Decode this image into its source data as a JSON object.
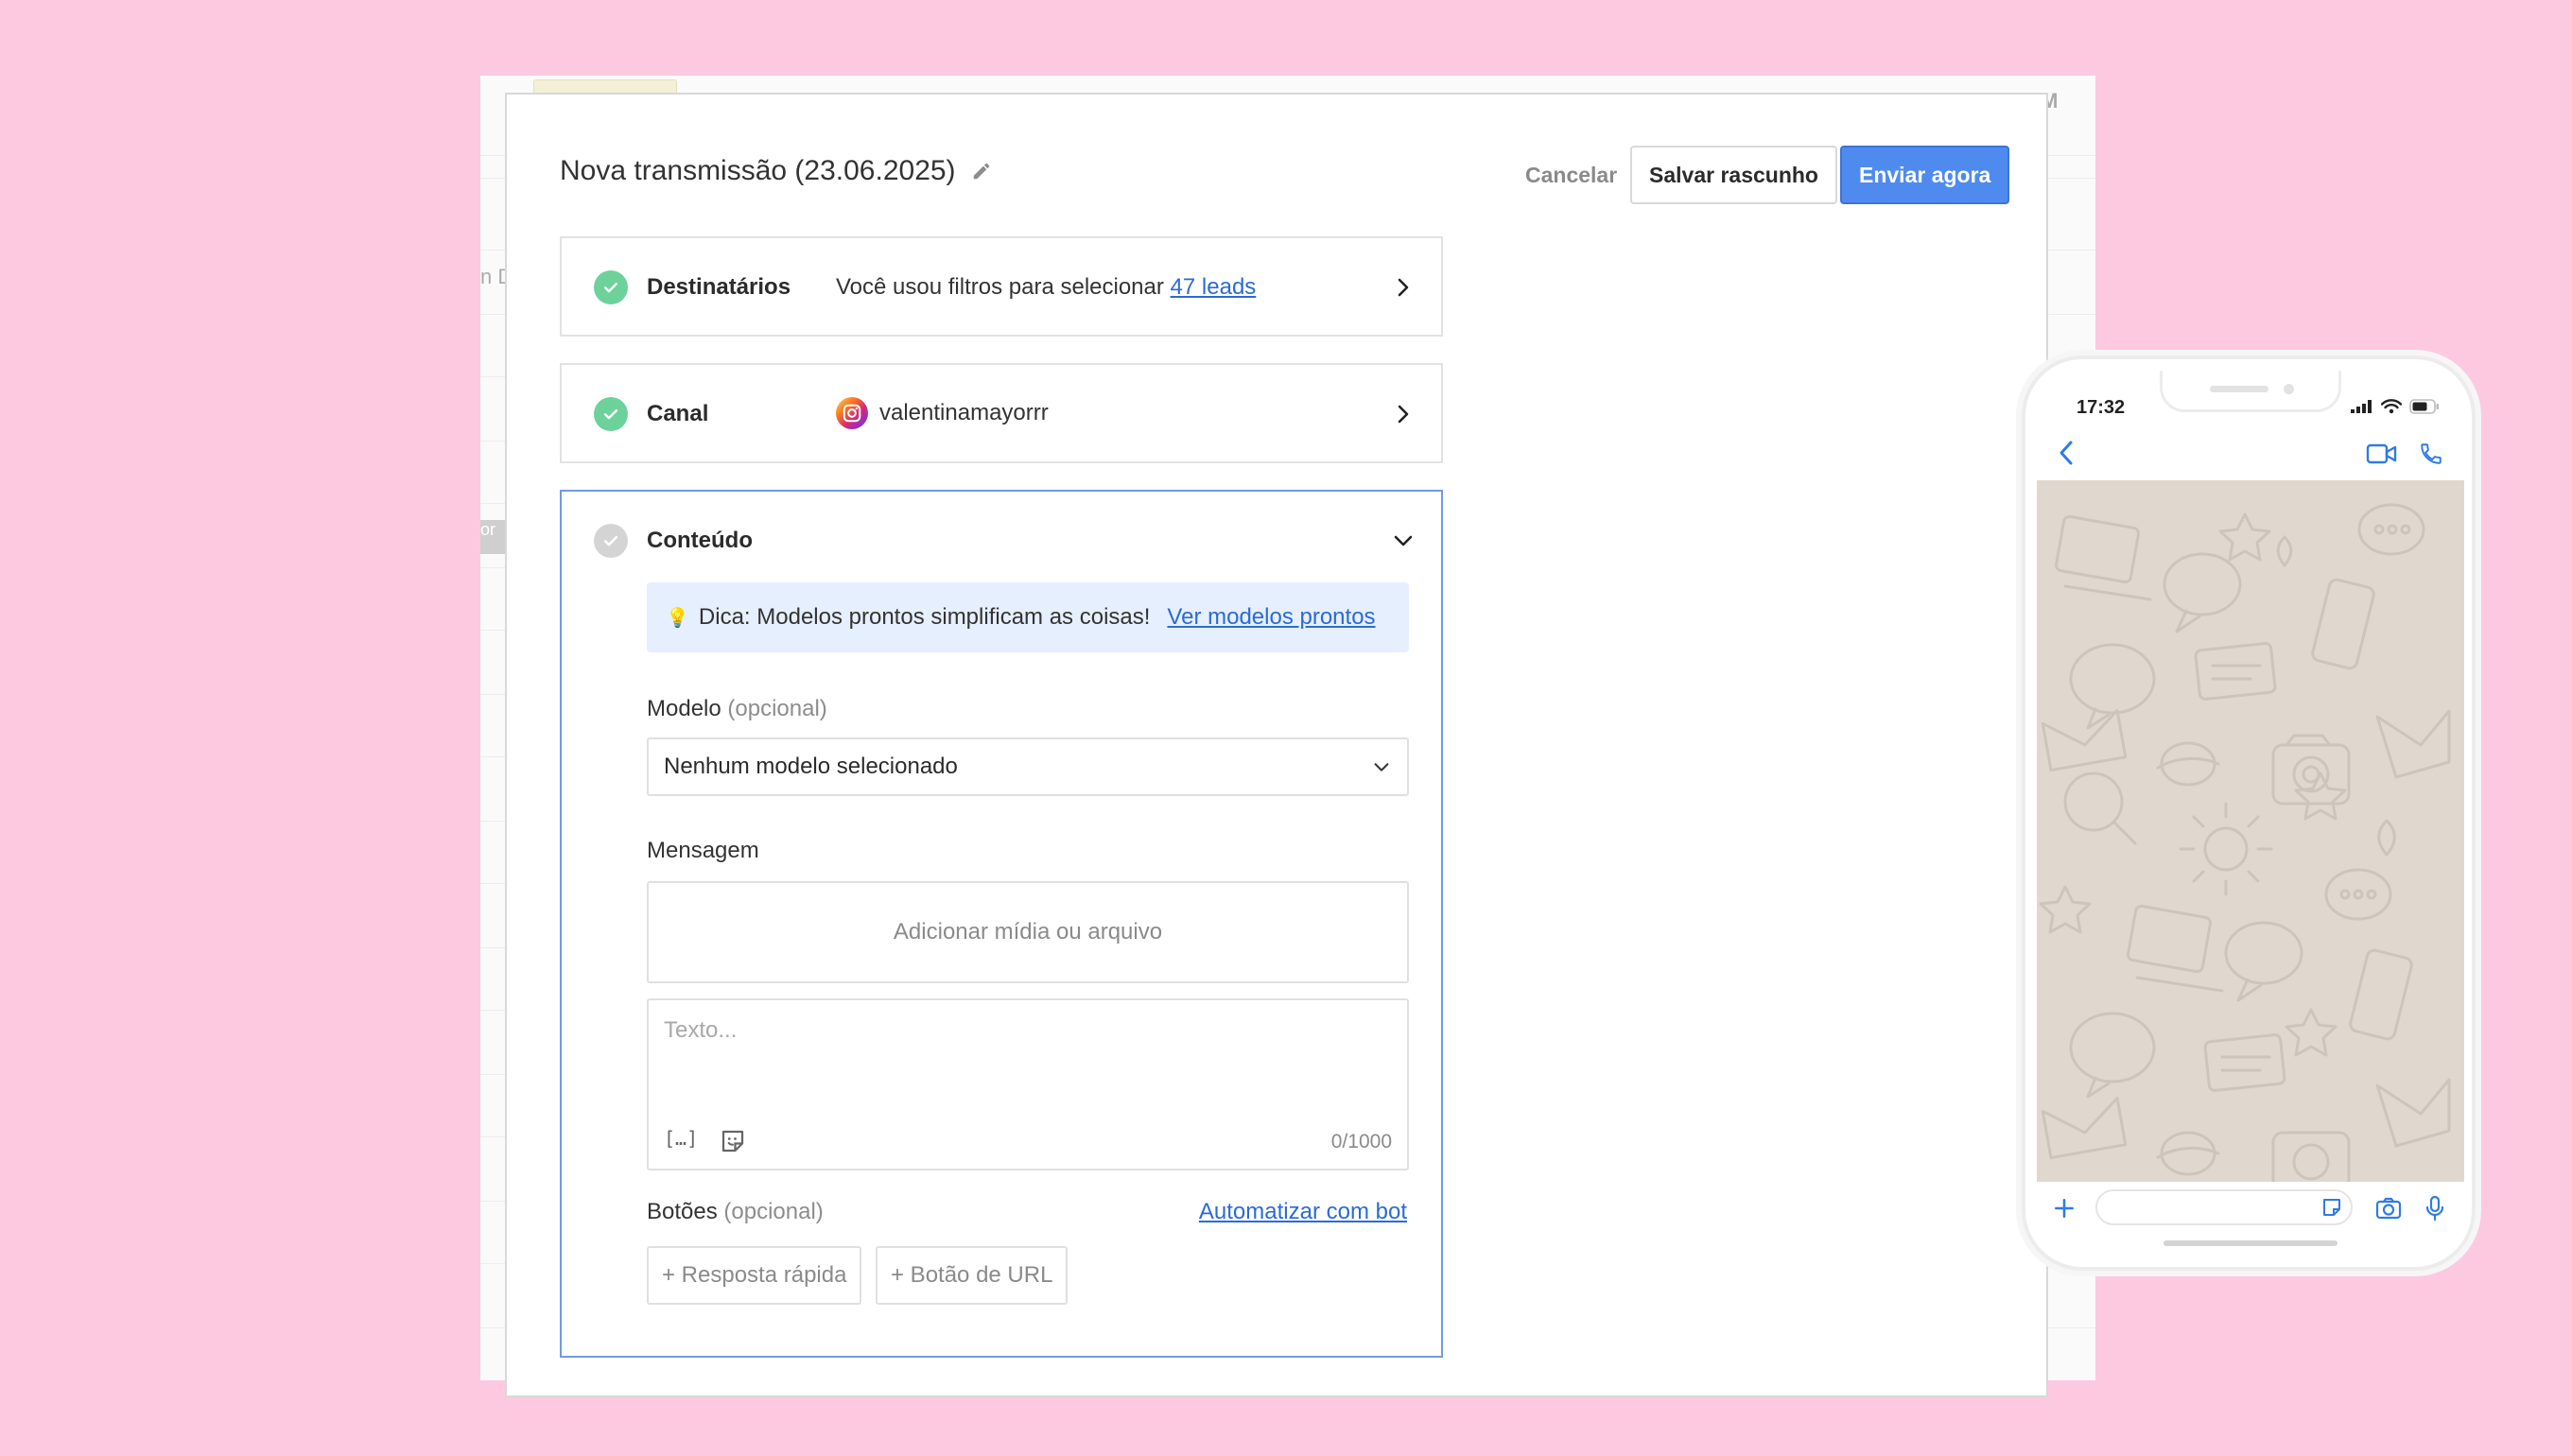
{
  "background_app": {
    "fragment_right": "TOM",
    "fragment_left": "n D",
    "fragment_label": "or"
  },
  "header": {
    "title": "Nova transmissão (23.06.2025)",
    "cancel_label": "Cancelar",
    "draft_label": "Salvar rascunho",
    "send_label": "Enviar agora"
  },
  "recipients": {
    "label": "Destinatários",
    "text": "Você usou filtros para selecionar",
    "link": "47 leads"
  },
  "channel": {
    "label": "Canal",
    "account": "valentinamayorrr",
    "icon": "instagram-icon"
  },
  "content": {
    "label": "Conteúdo",
    "tip_icon": "💡",
    "tip_text": "Dica: Modelos prontos simplificam as coisas!",
    "tip_link": "Ver modelos prontos",
    "model_label": "Modelo",
    "optional": "(opcional)",
    "model_selected": "Nenhum modelo selecionado",
    "message_label": "Mensagem",
    "media_label": "Adicionar mídia ou arquivo",
    "text_placeholder": "Texto...",
    "counter": "0/1000",
    "variable_icon": "[…]",
    "buttons_label": "Botões",
    "automate_link": "Automatizar com bot",
    "quick_reply": "+ Resposta rápida",
    "url_button": "+ Botão de URL"
  },
  "phone": {
    "time": "17:32"
  },
  "colors": {
    "page_bg": "#fdc9e1",
    "primary": "#4f8bef",
    "check_done": "#6cd29a",
    "link": "#2a6bd6",
    "tip_bg": "#e6effd",
    "chat_wallpaper": "#e0d8cf"
  }
}
